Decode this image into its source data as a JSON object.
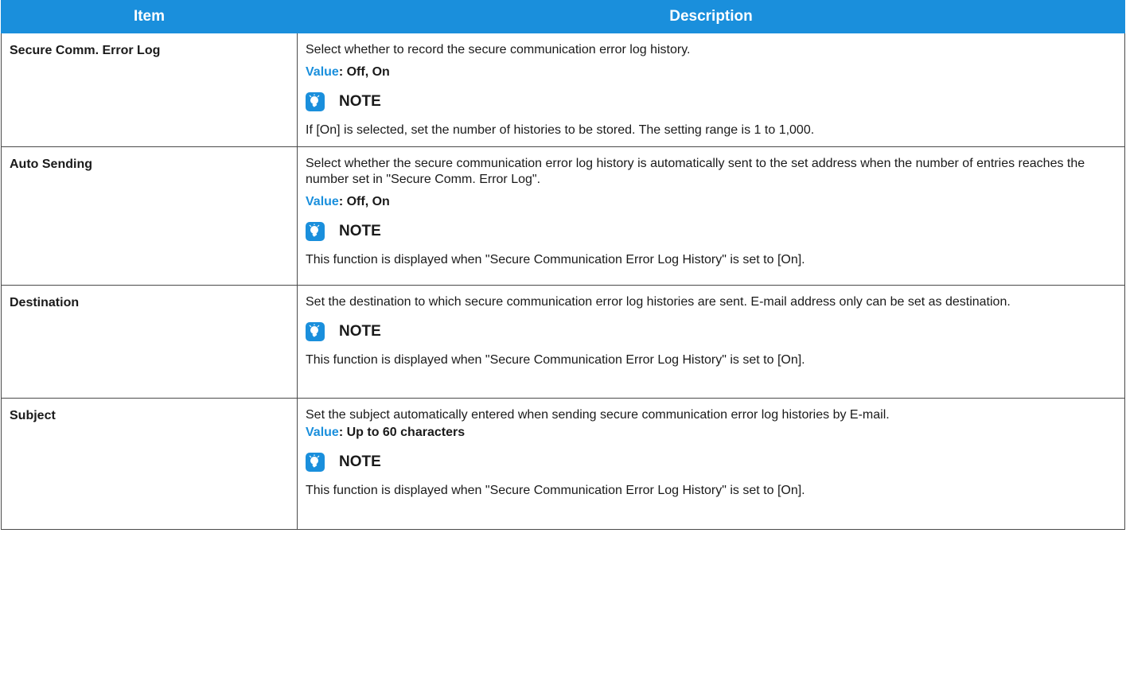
{
  "header": {
    "item": "Item",
    "description": "Description"
  },
  "colors": {
    "accent": "#1a8fdc",
    "border": "#4a4a4a"
  },
  "rows": [
    {
      "item": "Secure Comm. Error Log",
      "desc": "Select whether to record the secure communication error log history.",
      "value_label": "Value",
      "value_text": ": Off, On",
      "note_icon": "lightbulb-note-icon",
      "note_label": "NOTE",
      "note_text": "If [On] is selected, set the number of histories to be stored. The setting range is 1 to 1,000."
    },
    {
      "item": "Auto Sending",
      "desc": "Select whether the secure communication error log history is automatically sent to the set address when the number of entries reaches the number set in \"Secure Comm. Error Log\".",
      "value_label": "Value",
      "value_text": ": Off, On",
      "note_icon": "lightbulb-note-icon",
      "note_label": "NOTE",
      "note_text": "This function is displayed when \"Secure Communication Error Log History\" is set to [On]."
    },
    {
      "item": "Destination",
      "desc": "Set the destination to which secure communication error log histories are sent. E-mail address only can be set as destination.",
      "note_icon": "lightbulb-note-icon",
      "note_label": "NOTE",
      "note_text": "This function is displayed when \"Secure Communication Error Log History\" is set to [On]."
    },
    {
      "item": "Subject",
      "desc": "Set the subject automatically entered when sending secure communication error log histories by E-mail.",
      "value_label": "Value",
      "value_text": ": Up to 60 characters",
      "note_icon": "lightbulb-note-icon",
      "note_label": "NOTE",
      "note_text": "This function is displayed when \"Secure Communication Error Log History\" is set to [On]."
    }
  ]
}
